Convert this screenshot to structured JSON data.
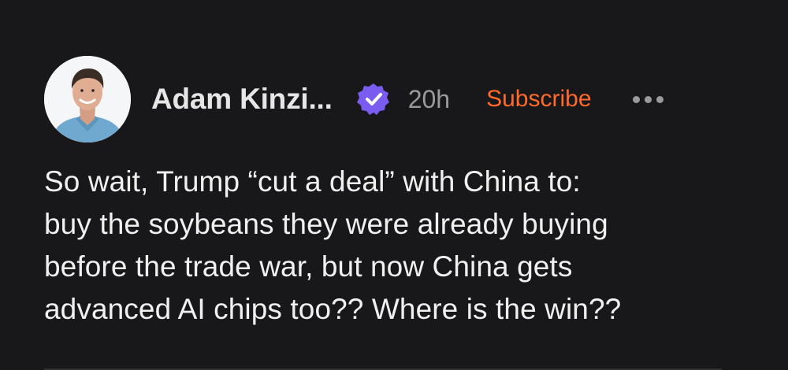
{
  "post": {
    "author_name": "Adam Kinzi...",
    "timestamp": "20h",
    "subscribe_label": "Subscribe",
    "verified_icon": "verified-check-icon",
    "more_icon": "more-horizontal-icon",
    "text_lines": [
      "So wait, Trump “cut a deal” with China to:",
      "buy the soybeans they were already buying",
      "before the trade war, but now China gets",
      "advanced AI chips too?? Where is the win??"
    ]
  },
  "colors": {
    "background": "#18181a",
    "accent": "#ff6a2b",
    "verified": "#7b5cf0",
    "muted": "#9a9a9e"
  }
}
